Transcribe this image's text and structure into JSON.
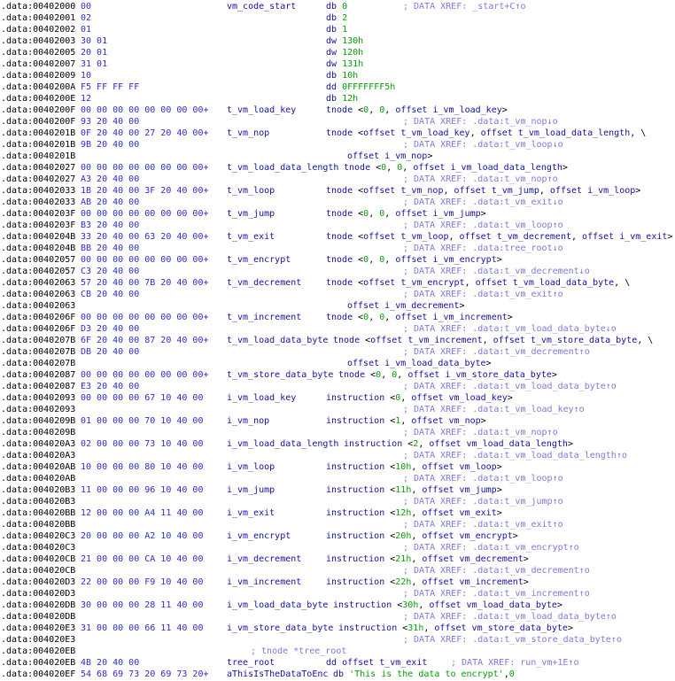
{
  "colors": {
    "background": "#ffffff",
    "address": "#000000",
    "bytes": "#2d2dd2",
    "identifier": "#12129e",
    "number": "#0a9b0a",
    "string": "#0a9b0a",
    "punctuation": "#000000",
    "comment": "#7b7bd9"
  },
  "listing": {
    "segment": ".data",
    "lines": [
      {
        "addr": ".data:00402000",
        "bytes": "00",
        "name": "vm_code_start",
        "def": "db 0",
        "comment": "; DATA XREF: _start+C↑o"
      },
      {
        "addr": ".data:00402001",
        "bytes": "02",
        "def": "db 2"
      },
      {
        "addr": ".data:00402002",
        "bytes": "01",
        "def": "db 1"
      },
      {
        "addr": ".data:00402003",
        "bytes": "30 01",
        "def": "dw 130h"
      },
      {
        "addr": ".data:00402005",
        "bytes": "20 01",
        "def": "dw 120h"
      },
      {
        "addr": ".data:00402007",
        "bytes": "31 01",
        "def": "dw 131h"
      },
      {
        "addr": ".data:00402009",
        "bytes": "10",
        "def": "db 10h"
      },
      {
        "addr": ".data:0040200A",
        "bytes": "F5 FF FF FF",
        "def": "dd 0FFFFFFF5h"
      },
      {
        "addr": ".data:0040200E",
        "bytes": "12",
        "def": "db 12h"
      },
      {
        "addr": ".data:0040200F",
        "bytes": "00 00 00 00 00 00 00 00+",
        "name": "t_vm_load_key",
        "def": "tnode <0, 0, offset i_vm_load_key>"
      },
      {
        "addr": ".data:0040200F",
        "bytes": "93 20 40 00",
        "comment": "; DATA XREF: .data:t_vm_nop↓o"
      },
      {
        "addr": ".data:0040201B",
        "bytes": "0F 20 40 00 27 20 40 00+",
        "name": "t_vm_nop",
        "def": "tnode <offset t_vm_load_key, offset t_vm_load_data_length, \\"
      },
      {
        "addr": ".data:0040201B",
        "bytes": "9B 20 40 00",
        "comment": "; DATA XREF: .data:t_vm_loop↓o"
      },
      {
        "addr": ".data:0040201B",
        "def": "offset i_vm_nop>",
        "defPos": "cont"
      },
      {
        "addr": ".data:00402027",
        "bytes": "00 00 00 00 00 00 00 00+",
        "name": "t_vm_load_data_length",
        "def": "tnode <0, 0, offset i_vm_load_data_length>"
      },
      {
        "addr": ".data:00402027",
        "bytes": "A3 20 40 00",
        "comment": "; DATA XREF: .data:t_vm_nop↑o"
      },
      {
        "addr": ".data:00402033",
        "bytes": "1B 20 40 00 3F 20 40 00+",
        "name": "t_vm_loop",
        "def": "tnode <offset t_vm_nop, offset t_vm_jump, offset i_vm_loop>"
      },
      {
        "addr": ".data:00402033",
        "bytes": "AB 20 40 00",
        "comment": "; DATA XREF: .data:t_vm_exit↓o"
      },
      {
        "addr": ".data:0040203F",
        "bytes": "00 00 00 00 00 00 00 00+",
        "name": "t_vm_jump",
        "def": "tnode <0, 0, offset i_vm_jump>"
      },
      {
        "addr": ".data:0040203F",
        "bytes": "B3 20 40 00",
        "comment": "; DATA XREF: .data:t_vm_loop↑o"
      },
      {
        "addr": ".data:0040204B",
        "bytes": "33 20 40 00 63 20 40 00+",
        "name": "t_vm_exit",
        "def": "tnode <offset t_vm_loop, offset t_vm_decrement, offset i_vm_exit>"
      },
      {
        "addr": ".data:0040204B",
        "bytes": "BB 20 40 00",
        "comment": "; DATA XREF: .data:tree_root↓o"
      },
      {
        "addr": ".data:00402057",
        "bytes": "00 00 00 00 00 00 00 00+",
        "name": "t_vm_encrypt",
        "def": "tnode <0, 0, offset i_vm_encrypt>"
      },
      {
        "addr": ".data:00402057",
        "bytes": "C3 20 40 00",
        "comment": "; DATA XREF: .data:t_vm_decrement↓o"
      },
      {
        "addr": ".data:00402063",
        "bytes": "57 20 40 00 7B 20 40 00+",
        "name": "t_vm_decrement",
        "def": "tnode <offset t_vm_encrypt, offset t_vm_load_data_byte, \\"
      },
      {
        "addr": ".data:00402063",
        "bytes": "CB 20 40 00",
        "comment": "; DATA XREF: .data:t_vm_exit↑o"
      },
      {
        "addr": ".data:00402063",
        "def": "offset i_vm_decrement>",
        "defPos": "cont"
      },
      {
        "addr": ".data:0040206F",
        "bytes": "00 00 00 00 00 00 00 00+",
        "name": "t_vm_increment",
        "def": "tnode <0, 0, offset i_vm_increment>"
      },
      {
        "addr": ".data:0040206F",
        "bytes": "D3 20 40 00",
        "comment": "; DATA XREF: .data:t_vm_load_data_byte↓o"
      },
      {
        "addr": ".data:0040207B",
        "bytes": "6F 20 40 00 87 20 40 00+",
        "name": "t_vm_load_data_byte",
        "def": "tnode <offset t_vm_increment, offset t_vm_store_data_byte, \\"
      },
      {
        "addr": ".data:0040207B",
        "bytes": "DB 20 40 00",
        "comment": "; DATA XREF: .data:t_vm_decrement↑o"
      },
      {
        "addr": ".data:0040207B",
        "def": "offset i_vm_load_data_byte>",
        "defPos": "cont"
      },
      {
        "addr": ".data:00402087",
        "bytes": "00 00 00 00 00 00 00 00+",
        "name": "t_vm_store_data_byte",
        "def": "tnode <0, 0, offset i_vm_store_data_byte>"
      },
      {
        "addr": ".data:00402087",
        "bytes": "E3 20 40 00",
        "comment": "; DATA XREF: .data:t_vm_load_data_byte↑o"
      },
      {
        "addr": ".data:00402093",
        "bytes": "00 00 00 00 67 10 40 00",
        "name": "i_vm_load_key",
        "def": "instruction <0, offset vm_load_key>"
      },
      {
        "addr": ".data:00402093",
        "comment": "; DATA XREF: .data:t_vm_load_key↑o"
      },
      {
        "addr": ".data:0040209B",
        "bytes": "01 00 00 00 70 10 40 00",
        "name": "i_vm_nop",
        "def": "instruction <1, offset vm_nop>"
      },
      {
        "addr": ".data:0040209B",
        "comment": "; DATA XREF: .data:t_vm_nop↑o"
      },
      {
        "addr": ".data:004020A3",
        "bytes": "02 00 00 00 73 10 40 00",
        "name": "i_vm_load_data_length",
        "def": "instruction <2, offset vm_load_data_length>"
      },
      {
        "addr": ".data:004020A3",
        "comment": "; DATA XREF: .data:t_vm_load_data_length↑o"
      },
      {
        "addr": ".data:004020AB",
        "bytes": "10 00 00 00 80 10 40 00",
        "name": "i_vm_loop",
        "def": "instruction <10h, offset vm_loop>"
      },
      {
        "addr": ".data:004020AB",
        "comment": "; DATA XREF: .data:t_vm_loop↑o"
      },
      {
        "addr": ".data:004020B3",
        "bytes": "11 00 00 00 96 10 40 00",
        "name": "i_vm_jump",
        "def": "instruction <11h, offset vm_jump>"
      },
      {
        "addr": ".data:004020B3",
        "comment": "; DATA XREF: .data:t_vm_jump↑o"
      },
      {
        "addr": ".data:004020BB",
        "bytes": "12 00 00 00 A4 11 40 00",
        "name": "i_vm_exit",
        "def": "instruction <12h, offset vm_exit>"
      },
      {
        "addr": ".data:004020BB",
        "comment": "; DATA XREF: .data:t_vm_exit↑o"
      },
      {
        "addr": ".data:004020C3",
        "bytes": "20 00 00 00 A2 10 40 00",
        "name": "i_vm_encrypt",
        "def": "instruction <20h, offset vm_encrypt>"
      },
      {
        "addr": ".data:004020C3",
        "comment": "; DATA XREF: .data:t_vm_encrypt↑o"
      },
      {
        "addr": ".data:004020CB",
        "bytes": "21 00 00 00 CA 10 40 00",
        "name": "i_vm_decrement",
        "def": "instruction <21h, offset vm_decrement>"
      },
      {
        "addr": ".data:004020CB",
        "comment": "; DATA XREF: .data:t_vm_decrement↑o"
      },
      {
        "addr": ".data:004020D3",
        "bytes": "22 00 00 00 F9 10 40 00",
        "name": "i_vm_increment",
        "def": "instruction <22h, offset vm_increment>"
      },
      {
        "addr": ".data:004020D3",
        "comment": "; DATA XREF: .data:t_vm_increment↑o"
      },
      {
        "addr": ".data:004020DB",
        "bytes": "30 00 00 00 28 11 40 00",
        "name": "i_vm_load_data_byte",
        "def": "instruction <30h, offset vm_load_data_byte>"
      },
      {
        "addr": ".data:004020DB",
        "comment": "; DATA XREF: .data:t_vm_load_data_byte↑o"
      },
      {
        "addr": ".data:004020E3",
        "bytes": "31 00 00 00 66 11 40 00",
        "name": "i_vm_store_data_byte",
        "def": "instruction <31h, offset vm_store_data_byte>"
      },
      {
        "addr": ".data:004020E3",
        "comment": "; DATA XREF: .data:t_vm_store_data_byte↑o"
      },
      {
        "addr": ".data:004020EB",
        "comment": "; tnode *tree_root",
        "commentPos": "mid"
      },
      {
        "addr": ".data:004020EB",
        "bytes": "4B 20 40 00",
        "name": "tree_root",
        "def": "dd offset t_vm_exit",
        "comment": "; DATA XREF: run_vm+1E↑o",
        "commentPos": "inline"
      },
      {
        "addr": ".data:004020EF",
        "bytes": "54 68 69 73 20 69 73 20+",
        "name": "aThisIsTheDataToEnc",
        "def": "db 'This is the data to encrypt',0"
      }
    ]
  }
}
